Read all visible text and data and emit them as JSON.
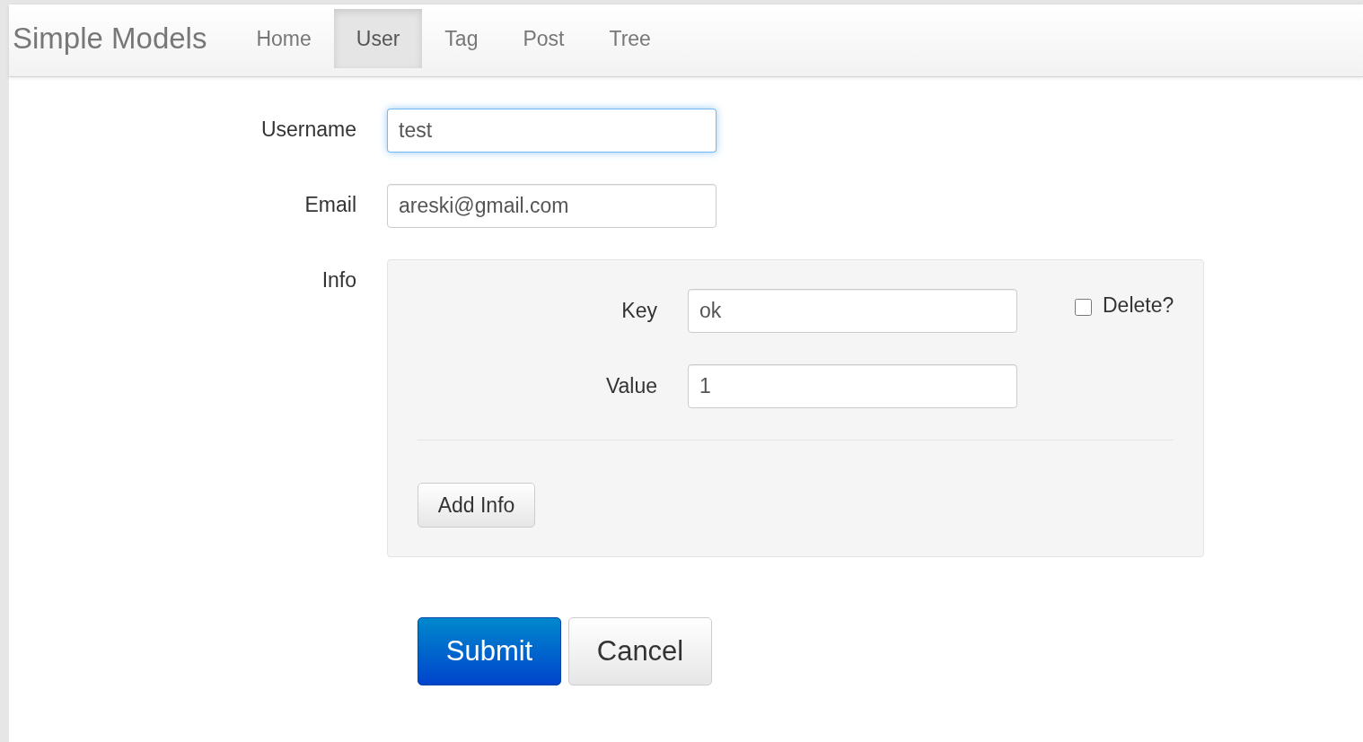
{
  "navbar": {
    "brand": "Simple Models",
    "tabs": [
      {
        "label": "Home",
        "selected": false
      },
      {
        "label": "User",
        "selected": true
      },
      {
        "label": "Tag",
        "selected": false
      },
      {
        "label": "Post",
        "selected": false
      },
      {
        "label": "Tree",
        "selected": false
      }
    ]
  },
  "form": {
    "fields": [
      {
        "label": "Username",
        "value": "test",
        "focused": true
      },
      {
        "label": "Email",
        "value": "areski@gmail.com",
        "focused": false
      }
    ],
    "info": {
      "label": "Info",
      "entries": [
        {
          "key_label": "Key",
          "key_value": "ok",
          "value_label": "Value",
          "value_value": "1",
          "delete_label": "Delete?",
          "delete_checked": false
        }
      ],
      "add_button": "Add Info"
    },
    "buttons": [
      {
        "label": "Submit",
        "kind": "primary"
      },
      {
        "label": "Cancel",
        "kind": "default"
      }
    ]
  }
}
